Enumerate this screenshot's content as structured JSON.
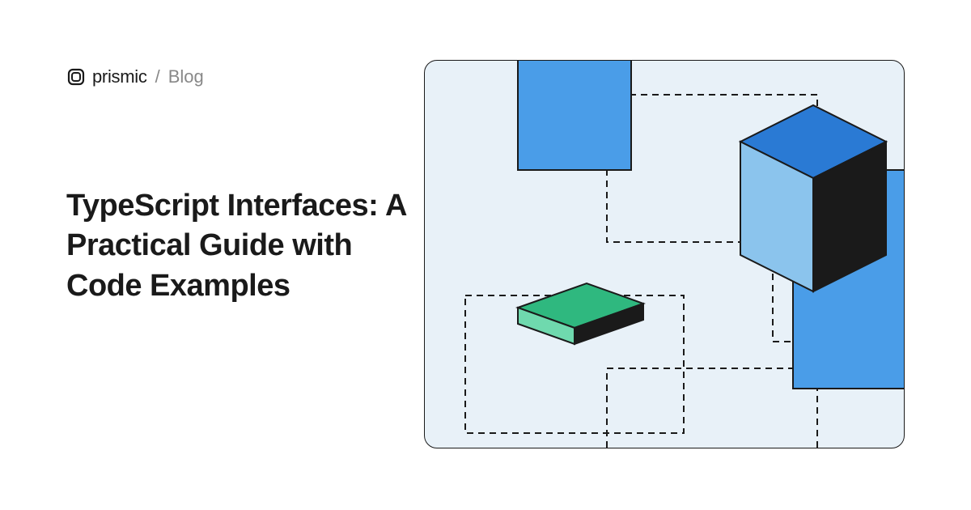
{
  "header": {
    "brand": "prismic",
    "separator": "/",
    "page": "Blog"
  },
  "title": "TypeScript Interfaces: A Practical Guide with Code Examples",
  "colors": {
    "background": "#ffffff",
    "illustration_bg": "#e8f1f8",
    "blue_medium": "#4a9de8",
    "blue_light": "#8bc4ed",
    "blue_dark": "#2a7ad4",
    "green": "#2fb87f",
    "green_light": "#6fd9ae",
    "black": "#1a1a1a"
  }
}
